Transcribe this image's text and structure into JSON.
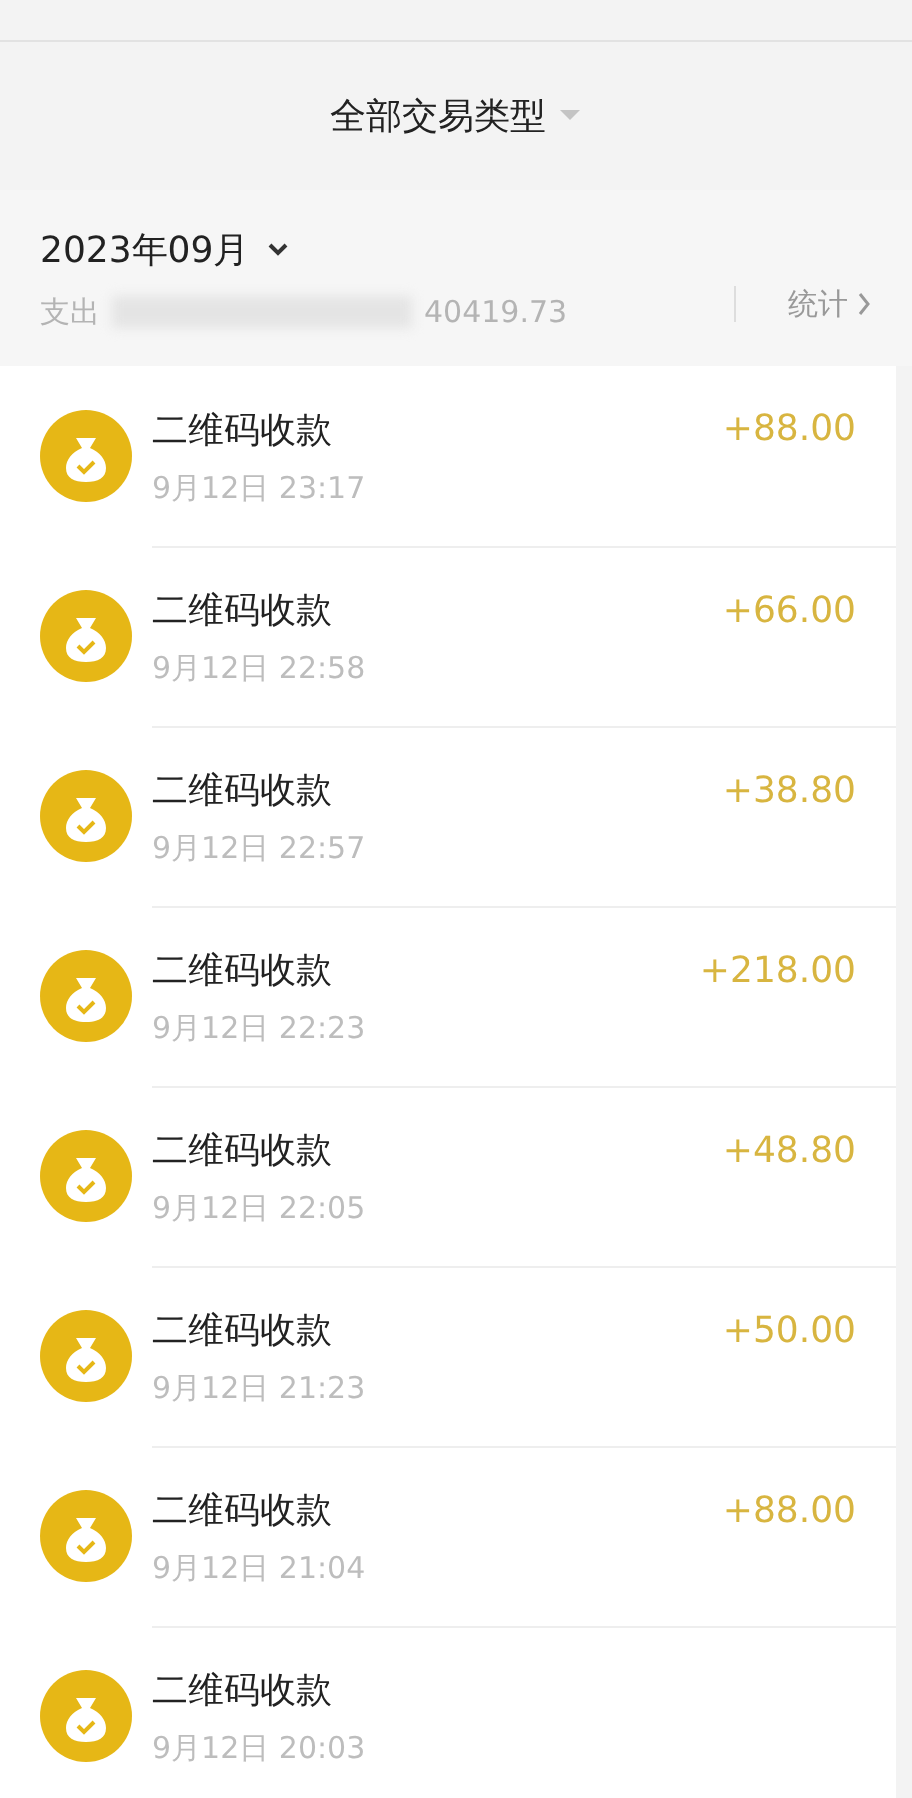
{
  "filter": {
    "label": "全部交易类型"
  },
  "month": {
    "label": "2023年09月",
    "expense_label": "支出",
    "expense_value": "40419.73",
    "stats_link": "统计"
  },
  "transactions": [
    {
      "title": "二维码收款",
      "time": "9月12日 23:17",
      "amount": "+88.00"
    },
    {
      "title": "二维码收款",
      "time": "9月12日 22:58",
      "amount": "+66.00"
    },
    {
      "title": "二维码收款",
      "time": "9月12日 22:57",
      "amount": "+38.80"
    },
    {
      "title": "二维码收款",
      "time": "9月12日 22:23",
      "amount": "+218.00"
    },
    {
      "title": "二维码收款",
      "time": "9月12日 22:05",
      "amount": "+48.80"
    },
    {
      "title": "二维码收款",
      "time": "9月12日 21:23",
      "amount": "+50.00"
    },
    {
      "title": "二维码收款",
      "time": "9月12日 21:04",
      "amount": "+88.00"
    },
    {
      "title": "二维码收款",
      "time": "9月12日 20:03"
    }
  ]
}
